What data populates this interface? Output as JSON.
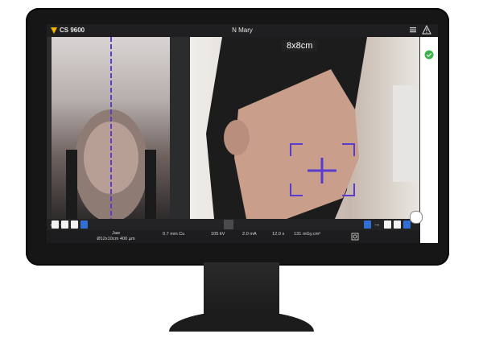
{
  "app": {
    "title": "CS 9600",
    "patient_name": "N Mary"
  },
  "camera": {
    "size_label": "8x8cm"
  },
  "status": {
    "region": "Jaw",
    "fov_resolution": "Ø12x10cm 400 µm",
    "filter": "0.7 mm Cu",
    "voltage": "105 kV",
    "current": "2.0 mA",
    "time": "12.0 s",
    "dose": "131 mGy.cm²"
  },
  "colors": {
    "accent": "#5a3bd0",
    "ok": "#39b54a",
    "status_bg": "#1d1d1f",
    "screen_bg": "#2b2c2e"
  },
  "icons": [
    "menu-icon",
    "warning-icon",
    "ok-indicator-icon",
    "crosshair-icon",
    "arrow-left-icon",
    "arrow-right-icon"
  ]
}
